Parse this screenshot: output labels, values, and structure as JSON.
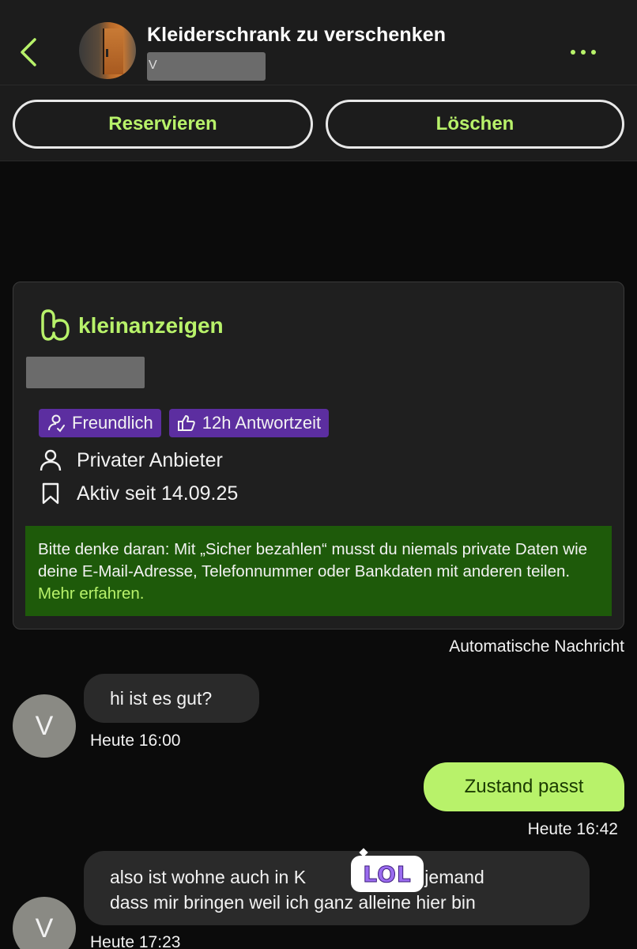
{
  "header": {
    "back_label": "<",
    "title": "Kleiderschrank zu verschenken",
    "name_initial": "V",
    "more_label": "..."
  },
  "actions": {
    "reserve_label": "Reservieren",
    "delete_label": "Löschen"
  },
  "card": {
    "brand": "kleinanzeigen",
    "badges": [
      {
        "label": "Freundlich",
        "icon": "friendly-user-icon"
      },
      {
        "label": "12h Antwortzeit",
        "icon": "thumbs-up-icon"
      }
    ],
    "seller_type": "Privater Anbieter",
    "active_since": "Aktiv seit 14.09.25",
    "notice_text": "Bitte denke daran: Mit „Sicher bezahlen“ musst du niemals private Daten wie deine E-Mail-Adresse, Telefonnummer oder Bankdaten mit anderen teilen.",
    "notice_link": "Mehr erfahren."
  },
  "auto_message_label": "Automatische Nachricht",
  "messages": [
    {
      "direction": "in",
      "avatar": "V",
      "text": "hi ist es gut?",
      "time": "Heute 16:00"
    },
    {
      "direction": "out",
      "text": "Zustand passt",
      "time": "Heute 16:42"
    },
    {
      "direction": "in",
      "avatar": "V",
      "text_line1": "also ist wohne auch in K",
      "text_line1_end": "kann jemand",
      "text_line2": "dass mir bringen weil ich ganz alleine hier bin",
      "time": "Heute 17:23"
    }
  ],
  "sticker": {
    "text": "LOL"
  },
  "colors": {
    "accent": "#b8f26a",
    "background": "#0b0b0b",
    "header_bg": "#1c1c1c",
    "badge_purple": "#5c2ea0",
    "notice_green": "#1e5a0a",
    "bubble_in": "#2a2a2a"
  }
}
